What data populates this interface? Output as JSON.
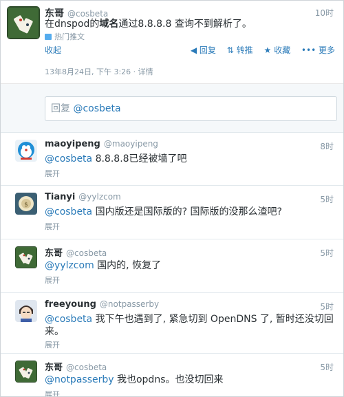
{
  "main": {
    "name": "东哥",
    "handle": "@cosbeta",
    "time": "10时",
    "text_pre": "在dnspod的",
    "text_bold": "域名",
    "text_post": "通过8.8.8.8 查询不到解析了。",
    "promoted": "热门推文",
    "collapse": "收起",
    "reply": "回复",
    "retweet": "转推",
    "favorite": "收藏",
    "more": "更多",
    "timestamp": "13年8月24日, 下午 3:26 · 详情",
    "reply_prefix": "回复",
    "reply_mention": "@cosbeta"
  },
  "replies": [
    {
      "name": "maoyipeng",
      "handle": "@maoyipeng",
      "time": "8时",
      "mention": "@cosbeta",
      "text": " 8.8.8.8已经被墙了吧",
      "line2": "",
      "expand": "展开"
    },
    {
      "name": "Tianyi",
      "handle": "@yylzcom",
      "time": "5时",
      "mention": "@cosbeta",
      "text": " 国内版还是国际版的? 国际版的没那么渣吧?",
      "line2": "",
      "expand": "展开"
    },
    {
      "name": "东哥",
      "handle": "@cosbeta",
      "time": "5时",
      "mention": "@yylzcom",
      "text": " 国内的, 恢复了",
      "line2": "",
      "expand": "展开"
    },
    {
      "name": "freeyoung",
      "handle": "@notpasserby",
      "time": "5时",
      "mention": "@cosbeta",
      "text": " 我下午也遇到了, 紧急切到 OpenDNS 了, 暂时还没切回",
      "line2": "来。",
      "expand": "展开"
    },
    {
      "name": "东哥",
      "handle": "@cosbeta",
      "time": "5时",
      "mention": "@notpasserby",
      "text": " 我也opdns。也没切回来",
      "line2": "",
      "expand": "展开"
    }
  ],
  "colors": {
    "link": "#2b7bb9",
    "muted": "#8899a6",
    "text": "#292f33"
  }
}
